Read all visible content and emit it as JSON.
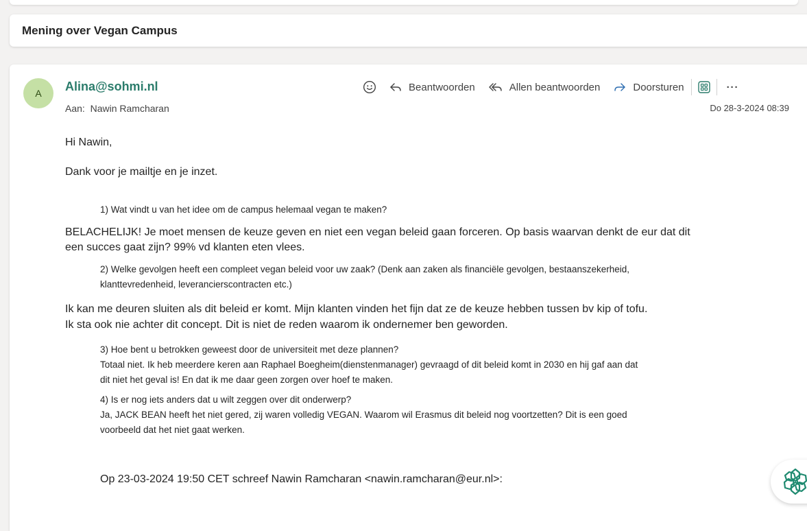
{
  "subject": "Mening over Vegan Campus",
  "message": {
    "avatar_initial": "A",
    "sender": "Alina@sohmi.nl",
    "to_label": "Aan:",
    "to_name": "Nawin Ramcharan",
    "date": "Do 28-3-2024 08:39",
    "actions": {
      "reply": "Beantwoorden",
      "reply_all": "Allen beantwoorden",
      "forward": "Doorsturen",
      "more": "···"
    },
    "greeting": "Hi Nawin,",
    "intro": "Dank voor je mailtje en je inzet.",
    "q1": "1) Wat vindt u van het idee om de campus helemaal vegan te maken?",
    "a1_line1": "BELACHELIJK! Je moet mensen de keuze geven en niet een vegan beleid gaan forceren. Op basis waarvan denkt de eur dat dit",
    "a1_line2": "een succes gaat zijn? 99% vd klanten eten vlees.",
    "q2_line1": "2) Welke gevolgen heeft een compleet vegan beleid voor uw zaak? (Denk aan zaken als financiële gevolgen, bestaanszekerheid,",
    "q2_line2": "klanttevredenheid, leverancierscontracten etc.)",
    "a2_line1": "Ik kan me deuren sluiten als dit beleid er komt. Mijn klanten vinden het fijn dat ze de keuze hebben tussen bv kip of tofu.",
    "a2_line2": "Ik sta ook nie achter dit concept.  Dit is niet de reden waarom ik ondernemer ben geworden.",
    "q3": "3) Hoe bent u betrokken geweest door de universiteit met deze plannen?",
    "a3_line1": "Totaal niet. Ik heb meerdere keren aan Raphael Boegheim(dienstenmanager) gevraagd of dit beleid komt in 2030 en hij gaf aan dat",
    "a3_line2": "dit niet het geval is! En dat ik me daar geen zorgen over hoef te maken.",
    "q4": "4) Is er nog iets anders dat u wilt zeggen over dit onderwerp?",
    "a4_line1": "Ja, JACK BEAN heeft het niet gered, zij waren volledig VEGAN. Waarom wil Erasmus dit beleid nog voortzetten? Dit is een goed",
    "a4_line2": "voorbeeld dat het niet gaat werken.",
    "quote_header": "Op 23-03-2024 19:50 CET schreef Nawin Ramcharan <nawin.ramcharan@eur.nl>:"
  },
  "icons": {
    "emoji": "smiley-icon",
    "reply": "reply-arrow-icon",
    "reply_all": "reply-all-arrow-icon",
    "forward": "forward-arrow-icon",
    "apps": "apps-grid-icon",
    "copilot": "copilot-icon"
  },
  "colors": {
    "accent": "#2b7c6b",
    "avatar_bg": "#c5e0a5",
    "background": "#f3f2f1"
  }
}
